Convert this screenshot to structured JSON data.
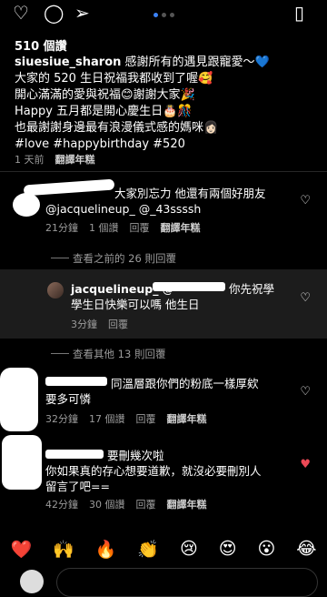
{
  "post": {
    "likes": "510 個讚",
    "username": "siuesiue_sharon",
    "caption_lines": [
      "感謝所有的遇見跟寵愛～💙",
      "大家的 520 生日祝福我都收到了喔🥰",
      "開心滿滿的愛與祝福😊謝謝大家🎉",
      "Happy 五月都是開心慶生日🎂🎊",
      "也最謝謝身邊最有浪漫儀式感的媽咪👩🏻",
      "#love #happybirthday #520"
    ],
    "time": "1 天前",
    "translate": "翻譯年糕"
  },
  "comments": [
    {
      "text_line1": "大家別忘力 他還有兩個好朋友",
      "text_line2": "@jacquelineup_ @_43ssssh",
      "time": "21分鐘",
      "likes": "1 個讚",
      "reply": "回覆",
      "translate": "翻譯年糕"
    },
    {
      "username": "jacquelineup_",
      "mention": "@",
      "text_line1": "你先祝學",
      "text_line2": "學生日快樂可以嗎 他生日",
      "time": "3分鐘",
      "reply": "回覆"
    },
    {
      "text_line1": "同溫層跟你們的粉底一樣厚欸",
      "text_line2": "要多可憐",
      "time": "32分鐘",
      "likes": "17 個讚",
      "reply": "回覆",
      "translate": "翻譯年糕"
    },
    {
      "text_line1": "要刪幾次啦",
      "text_line2": "你如果真的存心想要道歉，就沒必要刪別人",
      "text_line3": "留言了吧==",
      "time": "42分鐘",
      "likes": "30 個讚",
      "reply": "回覆",
      "translate": "翻譯年糕"
    }
  ],
  "view_prev_replies": "查看之前的 26 則回覆",
  "view_more_replies": "查看其他 13 則回覆",
  "emoji_bar": [
    "❤️",
    "🙌",
    "🔥",
    "👏",
    "😢",
    "😍",
    "😮",
    "😂"
  ],
  "icons": [
    "heart-outline-icon",
    "comment-icon",
    "share-icon",
    "bookmark-icon"
  ],
  "colors": {
    "accent": "#3b82f6",
    "liked": "#ed4956",
    "muted": "#9a9a9a"
  }
}
